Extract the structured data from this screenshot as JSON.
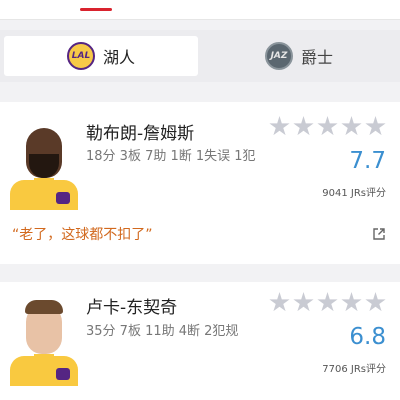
{
  "teams": {
    "active": {
      "name": "湖人",
      "logo_text": "LAL",
      "icon": "lakers-logo-icon"
    },
    "inactive": {
      "name": "爵士",
      "logo_text": "JAZ",
      "icon": "jazz-logo-icon"
    }
  },
  "players": [
    {
      "name": "勒布朗-詹姆斯",
      "stats": "18分 3板 7助 1断 1失误 1犯规",
      "score": "7.7",
      "rating_count": "9041 JRs评分",
      "comment": "“老了，这球都不扣了”",
      "stars_filled": 0
    },
    {
      "name": "卢卡-东契奇",
      "stats": "35分 7板 11助 4断 2犯规",
      "score": "6.8",
      "rating_count": "7706 JRs评分",
      "stars_filled": 0
    }
  ],
  "colors": {
    "accent_red": "#d9232e",
    "score_blue": "#3b8fd0",
    "comment_orange": "#d2691e",
    "star_gray": "#c9cbd3"
  }
}
